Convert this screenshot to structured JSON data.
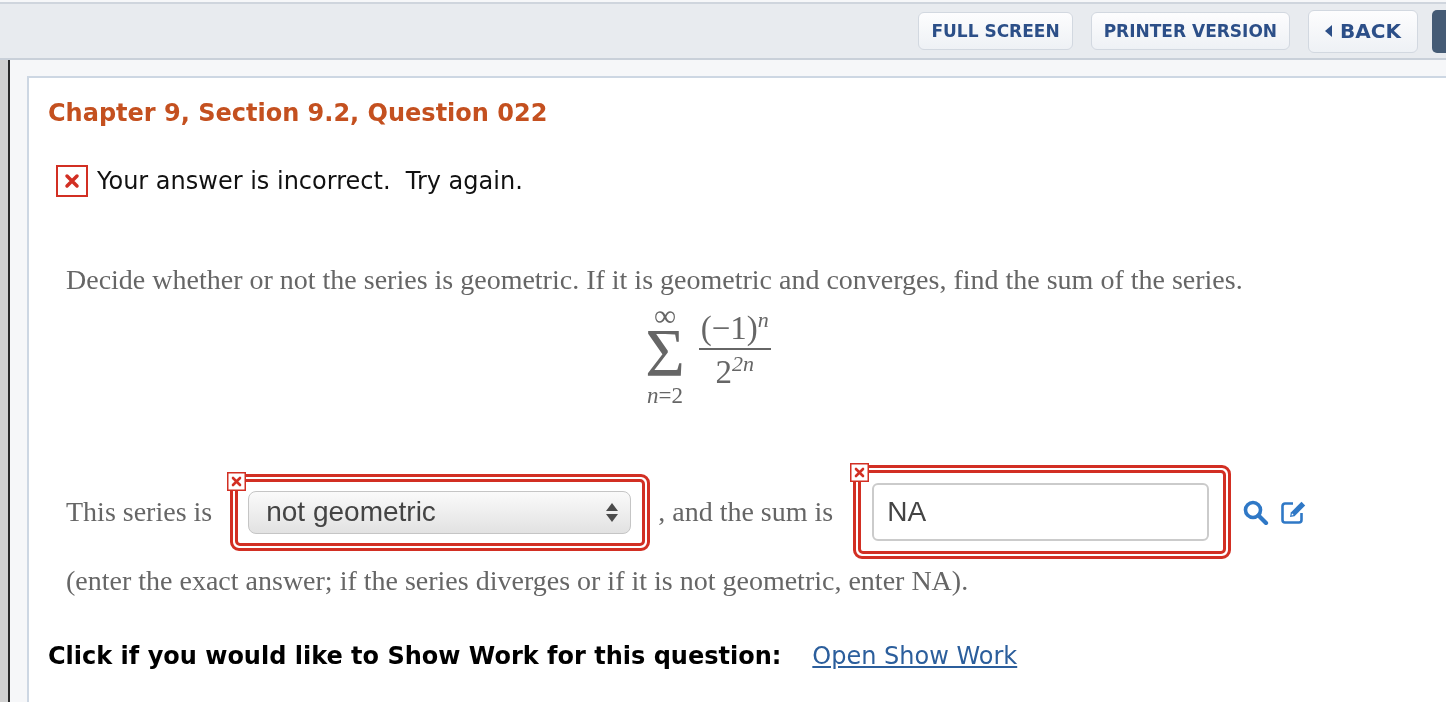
{
  "toolbar": {
    "buttons": [
      {
        "kind": "text",
        "label": "FULL SCREEN"
      },
      {
        "kind": "text",
        "label": "PRINTER VERSION"
      },
      {
        "kind": "back",
        "label": "BACK"
      },
      {
        "kind": "edge"
      }
    ]
  },
  "question": {
    "title": "Chapter 9, Section 9.2, Question 022",
    "feedback": {
      "text": "Your answer is incorrect.  Try again.",
      "correct": false
    },
    "prompt": "Decide whether or not the series is geometric. If it is geometric and converges, find the sum of the series.",
    "series": {
      "upper_limit": "∞",
      "symbol": "Σ",
      "lower_limit": "*n*=2",
      "numerator": "(−1)$^{n}$",
      "denominator": "2$^{2n}$"
    },
    "answer_line": {
      "prefix": "This series is",
      "select": {
        "value": "not geometric",
        "correct": false
      },
      "middle": ", and the sum is",
      "input": {
        "value": "NA",
        "correct": false
      }
    },
    "note": "(enter the exact answer; if the series diverges or if it is not geometric, enter NA).",
    "show_work": {
      "label": "Click if you would like to Show Work for this question:",
      "link": "Open Show Work"
    }
  }
}
